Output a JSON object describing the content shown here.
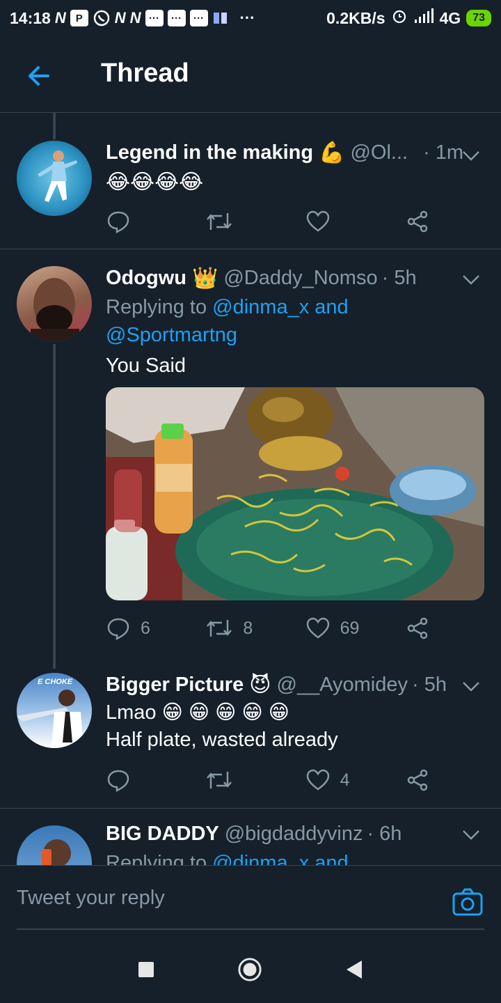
{
  "status_bar": {
    "time": "14:18",
    "notif_icons": [
      "N",
      "P",
      "whatsapp",
      "N",
      "N",
      "msg",
      "msg",
      "msg",
      "docs",
      "..."
    ],
    "speed": "0.2KB/s",
    "network": "4G",
    "battery": "73"
  },
  "header": {
    "title": "Thread"
  },
  "tweets": [
    {
      "name": "Legend in the making",
      "name_emoji": "💪",
      "handle": "@Ol...",
      "time": "· 1m",
      "text": "😂😂😂😂",
      "actions": {
        "reply": "",
        "retweet": "",
        "like": ""
      }
    },
    {
      "name": "Odogwu",
      "name_emoji": "👑",
      "handle": "@Daddy_Nomso",
      "time": "· 5h",
      "reply_prefix": "Replying to",
      "reply_user1": "@dinma_x",
      "reply_and": "and",
      "reply_user2": "@Sportmartng",
      "text": "You Said",
      "actions": {
        "reply": "6",
        "retweet": "8",
        "like": "69"
      }
    },
    {
      "name": "Bigger Picture",
      "name_emoji": "😈",
      "handle": "@__Ayomidey",
      "time": "· 5h",
      "avatar_text": "E CHOKE",
      "text_line1": "Lmao 😁 😁 😁 😁 😁",
      "text_line2": "Half plate, wasted already",
      "actions": {
        "reply": "",
        "retweet": "",
        "like": "4"
      }
    },
    {
      "name": "BIG DADDY",
      "handle": "@bigdaddyvinz",
      "time": "· 6h",
      "reply_prefix": "Replying to",
      "reply_user1": "@dinma_x",
      "reply_and": "and"
    }
  ],
  "reply_bar": {
    "placeholder": "Tweet your reply"
  },
  "colors": {
    "background": "#15202b",
    "accent": "#1da1f2",
    "muted": "#8899a6",
    "divider": "#38444d"
  }
}
